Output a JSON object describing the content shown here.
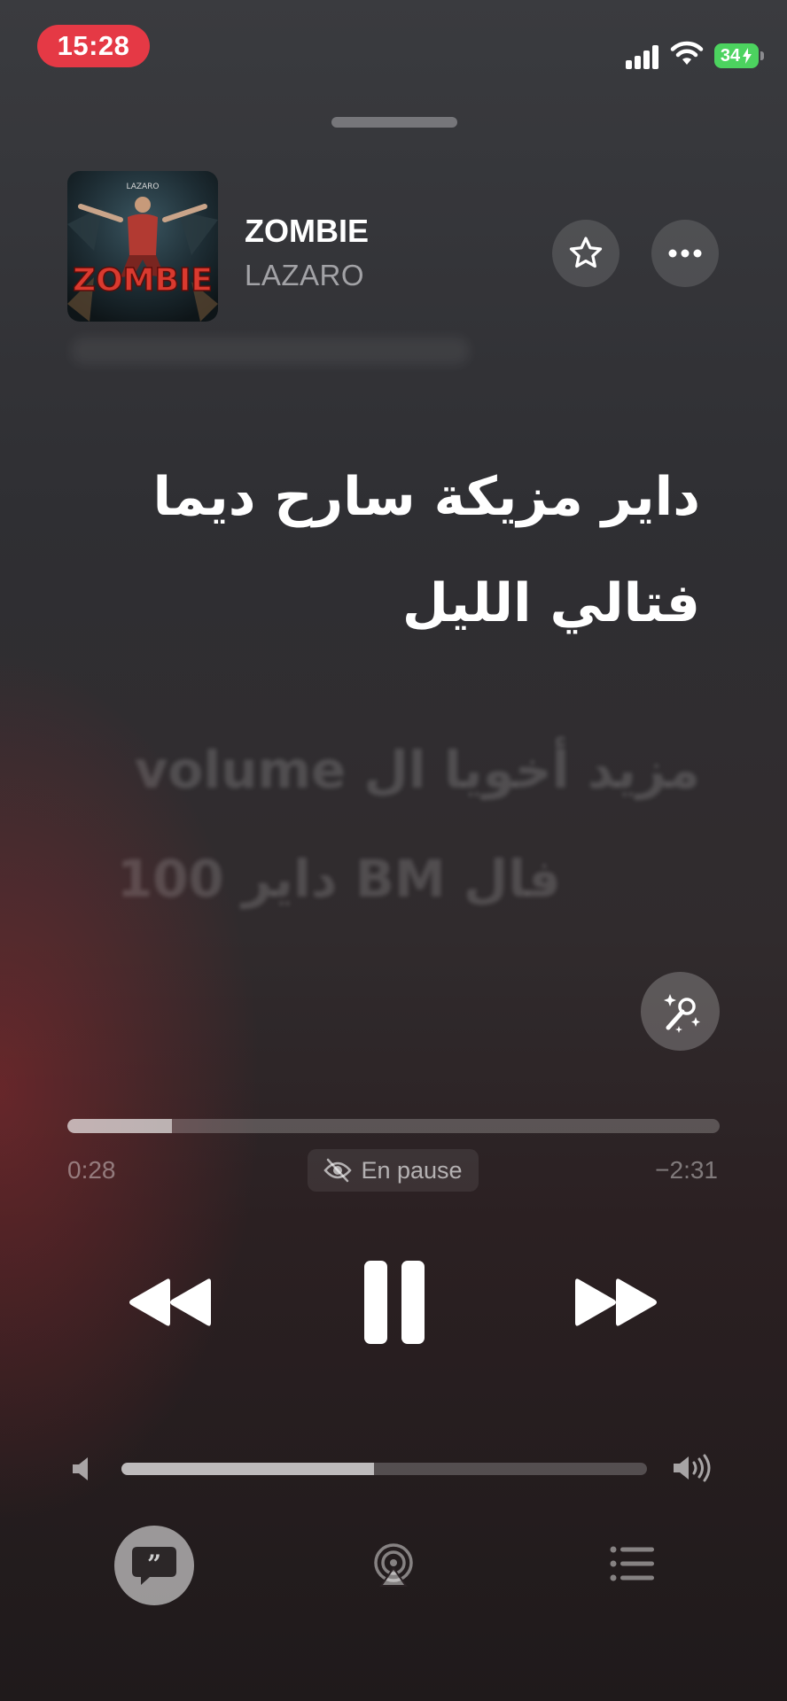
{
  "status_bar": {
    "time": "15:28",
    "battery": "34",
    "accent_color": "#e53945",
    "battery_color": "#4cd35f"
  },
  "now_playing": {
    "title": "ZOMBIE",
    "artist": "LAZARO",
    "artwork_text": "ZOMBIE",
    "artwork_label": "LAZARO"
  },
  "header_actions": {
    "favorite_icon": "star-icon",
    "more_icon": "ellipsis-icon"
  },
  "lyrics": {
    "active_lines": [
      "داير مزيكة سارح ديما",
      "فتالي الليل"
    ],
    "next_lines": [
      "مزيد أخويا ال volume",
      "فال BM داير 100"
    ],
    "sing_icon": "microphone-sparkle-icon"
  },
  "progress": {
    "elapsed": "0:28",
    "remaining": "−2:31",
    "fraction": 0.16,
    "status_label": "En pause",
    "status_icon": "eye-slash-icon"
  },
  "transport": {
    "rewind_icon": "backward-icon",
    "play_pause_icon": "pause-icon",
    "forward_icon": "forward-icon"
  },
  "volume": {
    "level": 0.48,
    "low_icon": "speaker-low-icon",
    "high_icon": "speaker-high-icon"
  },
  "bottom_bar": {
    "lyrics_icon": "quote-bubble-icon",
    "airplay_icon": "airplay-icon",
    "queue_icon": "list-icon"
  }
}
